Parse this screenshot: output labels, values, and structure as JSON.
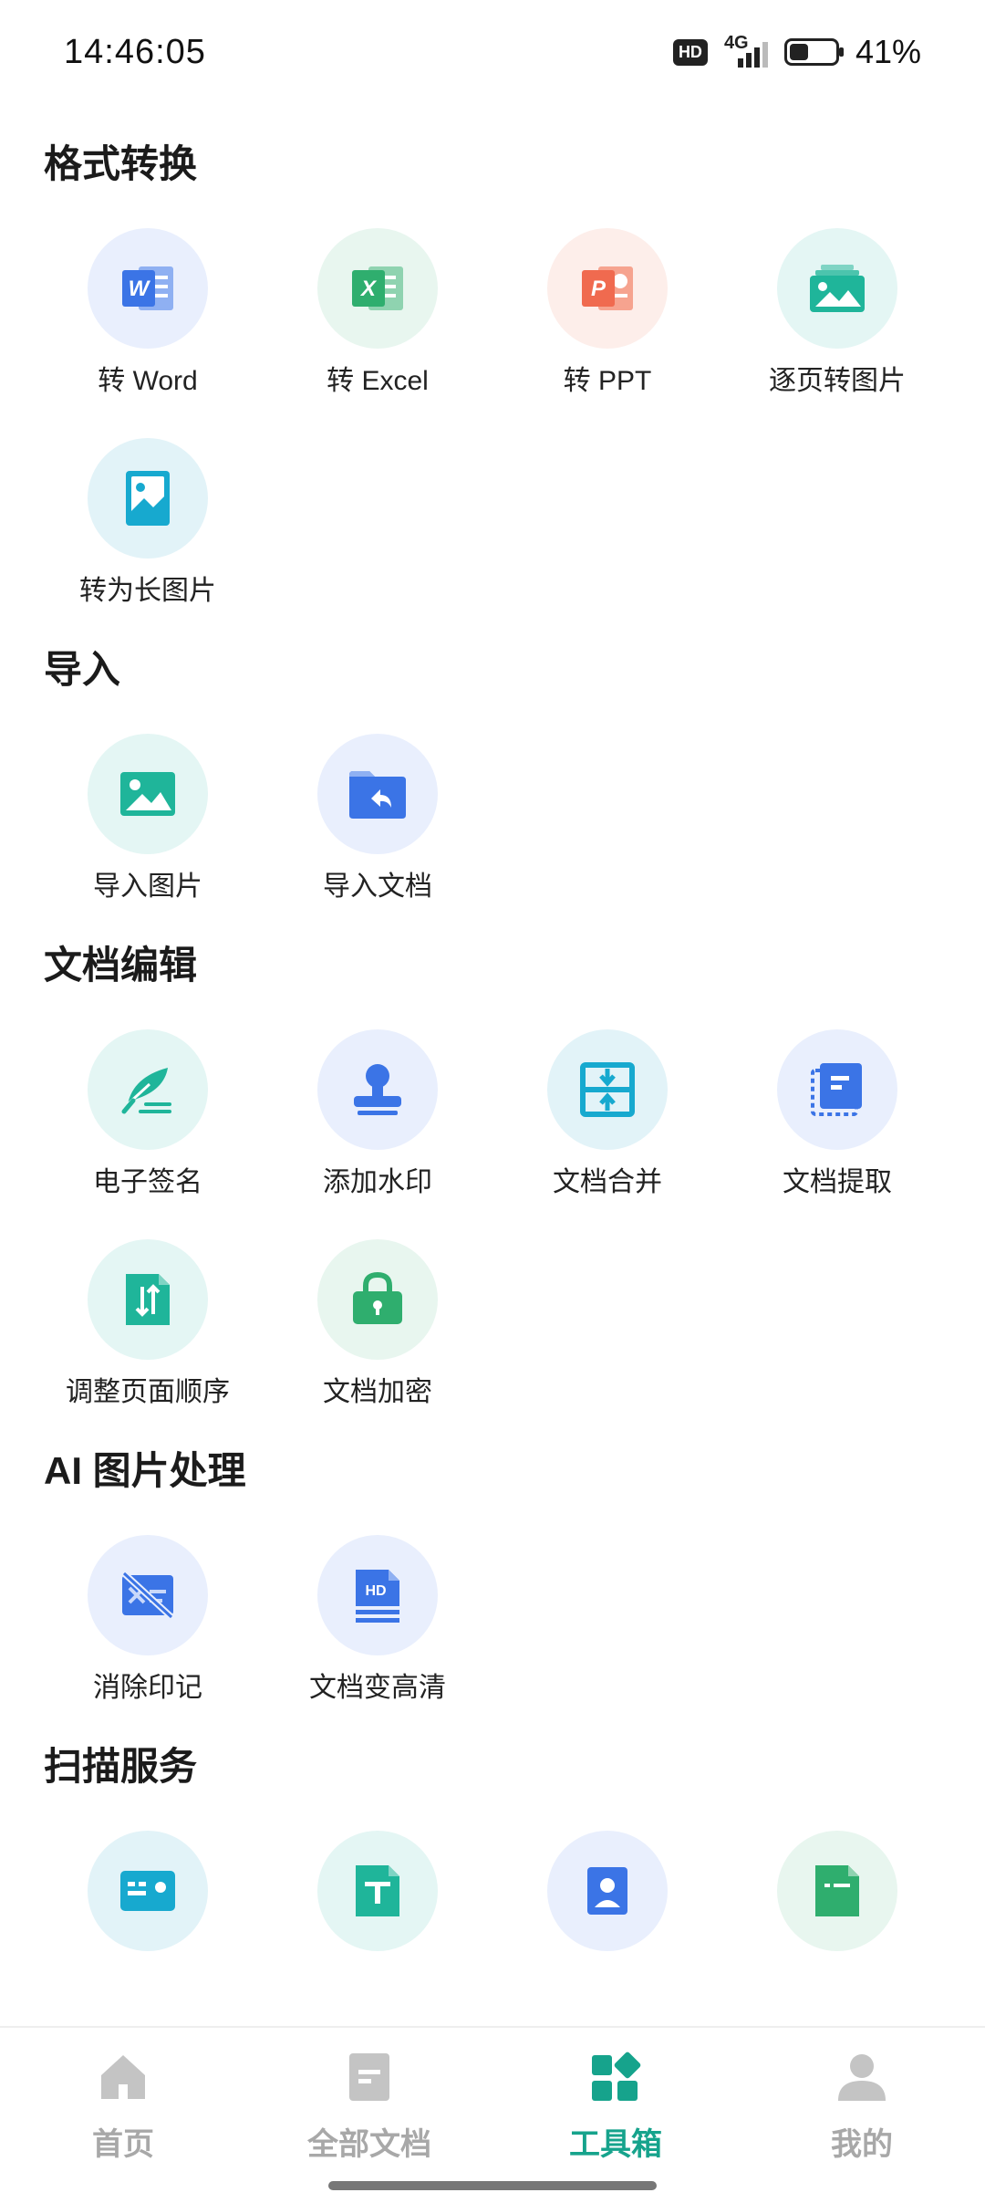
{
  "status_bar": {
    "time": "14:46:05",
    "hd": "HD",
    "network": "4G",
    "battery": "41%",
    "battery_level": 0.41
  },
  "sections": {
    "format": {
      "title": "格式转换",
      "items": [
        "转 Word",
        "转 Excel",
        "转 PPT",
        "逐页转图片",
        "转为长图片"
      ]
    },
    "import": {
      "title": "导入",
      "items": [
        "导入图片",
        "导入文档"
      ]
    },
    "edit": {
      "title": "文档编辑",
      "items": [
        "电子签名",
        "添加水印",
        "文档合并",
        "文档提取",
        "调整页面顺序",
        "文档加密"
      ]
    },
    "ai": {
      "title": "AI 图片处理",
      "items": [
        "消除印记",
        "文档变高清"
      ]
    },
    "scan": {
      "title": "扫描服务"
    }
  },
  "nav": {
    "home": "首页",
    "docs": "全部文档",
    "tools": "工具箱",
    "me": "我的"
  },
  "colors": {
    "accent": "#16a38c",
    "word": "#3b74e6",
    "excel": "#2fae6e",
    "ppt": "#f06a4f",
    "teal": "#1fb59a",
    "cyan": "#17a9cf"
  }
}
